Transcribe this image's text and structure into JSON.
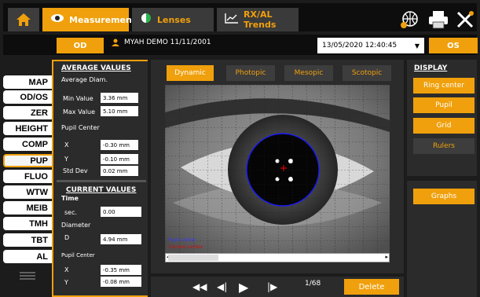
{
  "tabs": [
    {
      "label": "Measurements",
      "icon": "eye-icon",
      "active": true
    },
    {
      "label": "Lenses",
      "icon": "lens-icon",
      "active": false
    },
    {
      "label": "RX/AL Trends",
      "icon": "trend-chart-icon",
      "active": false
    }
  ],
  "subbar": {
    "od_label": "OD",
    "patient": "MYAH DEMO 11/11/2001",
    "exam_date": "13/05/2020 12:40:45",
    "os_label": "OS"
  },
  "nav": [
    "MAP",
    "OD/OS",
    "ZER",
    "HEIGHT",
    "COMP",
    "PUP",
    "FLUO",
    "WTW",
    "MEIB",
    "TMH",
    "TBT",
    "AL"
  ],
  "nav_active": "PUP",
  "average": {
    "title": "AVERAGE VALUES",
    "diam_label": "Average Diam.",
    "min_label": "Min Value",
    "min_value": "3.36 mm",
    "max_label": "Max Value",
    "max_value": "5.10 mm",
    "center_label": "Pupil Center",
    "x_label": "X",
    "x_value": "-0.30 mm",
    "y_label": "Y",
    "y_value": "-0.10 mm",
    "sd_label": "Std Dev",
    "sd_value": "0.02 mm"
  },
  "current": {
    "title": "CURRENT VALUES",
    "time_label": "Time",
    "sec_label": "sec.",
    "sec_value": "0.00",
    "diam_label": "Diameter",
    "d_label": "D",
    "d_value": "4.94 mm",
    "center_label": "Pupil Center",
    "x_label": "X",
    "x_value": "-0.35 mm",
    "y_label": "Y",
    "y_value": "-0.08 mm"
  },
  "modes": [
    "Dynamic",
    "Photopic",
    "Mesopic",
    "Scotopic"
  ],
  "mode_active": "Dynamic",
  "overlay": {
    "pupil_center": "Pupil center",
    "corneal_vertex": "Corneal vertex"
  },
  "playback": {
    "frame": "1/68",
    "delete_label": "Delete"
  },
  "display": {
    "title": "DISPLAY",
    "buttons": [
      {
        "label": "Ring center",
        "on": true
      },
      {
        "label": "Pupil",
        "on": true
      },
      {
        "label": "Grid",
        "on": true
      },
      {
        "label": "Rulers",
        "on": false
      }
    ],
    "graphs_label": "Graphs"
  },
  "colors": {
    "accent": "#f0a00c",
    "pupil_outline": "#1a1aff",
    "center_mark": "#ff0000"
  }
}
